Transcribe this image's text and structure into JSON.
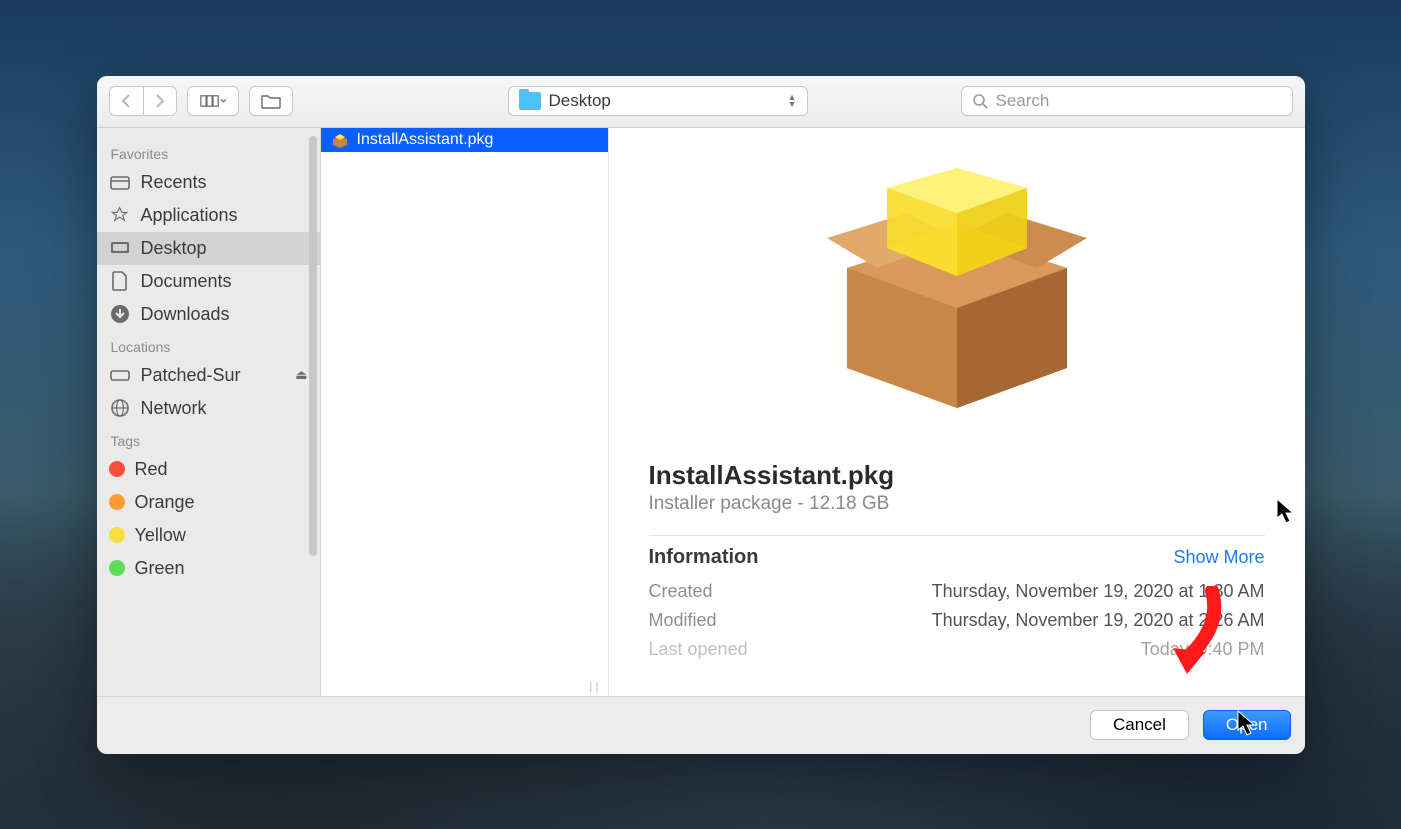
{
  "toolbar": {
    "location_label": "Desktop",
    "search_placeholder": "Search"
  },
  "sidebar": {
    "sections": {
      "favorites": {
        "header": "Favorites",
        "items": [
          {
            "label": "Recents"
          },
          {
            "label": "Applications"
          },
          {
            "label": "Desktop"
          },
          {
            "label": "Documents"
          },
          {
            "label": "Downloads"
          }
        ]
      },
      "locations": {
        "header": "Locations",
        "items": [
          {
            "label": "Patched-Sur"
          },
          {
            "label": "Network"
          }
        ]
      },
      "tags": {
        "header": "Tags",
        "items": [
          {
            "label": "Red",
            "color": "#ff4d3d"
          },
          {
            "label": "Orange",
            "color": "#ff9a2e"
          },
          {
            "label": "Yellow",
            "color": "#f7df3a"
          },
          {
            "label": "Green",
            "color": "#5bdc5b"
          }
        ]
      }
    }
  },
  "file_list": {
    "items": [
      {
        "label": "InstallAssistant.pkg"
      }
    ]
  },
  "preview": {
    "filename": "InstallAssistant.pkg",
    "kind_size": "Installer package - 12.18 GB",
    "info_header": "Information",
    "show_more": "Show More",
    "meta": [
      {
        "label": "Created",
        "value": "Thursday, November 19, 2020 at 1:30 AM"
      },
      {
        "label": "Modified",
        "value": "Thursday, November 19, 2020 at 2:26 AM"
      },
      {
        "label": "Last opened",
        "value": "Today, 9:40 PM"
      }
    ]
  },
  "footer": {
    "cancel": "Cancel",
    "open": "Open"
  }
}
